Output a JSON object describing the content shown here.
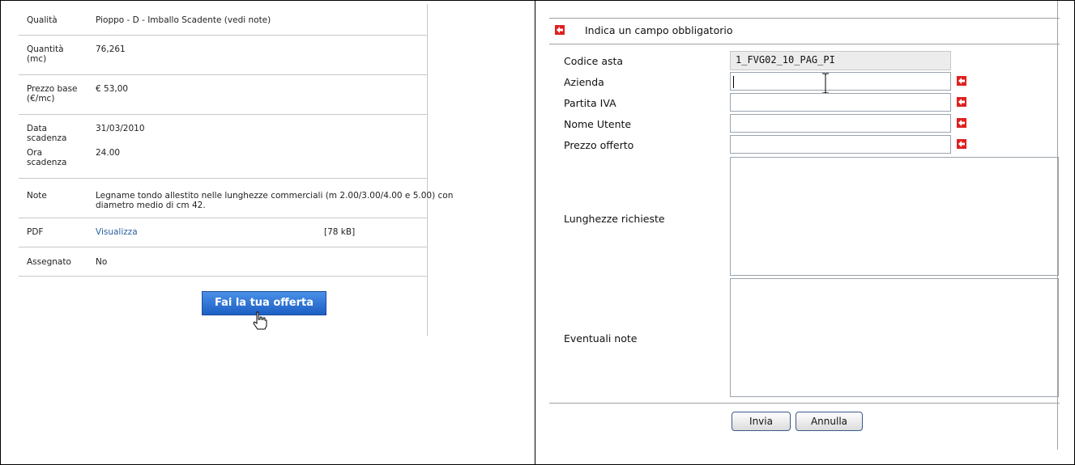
{
  "left": {
    "rows": [
      {
        "label": "Qualità",
        "value": "Pioppo - D - Imballo Scadente (vedi note)"
      },
      {
        "label": "Quantità\n(mc)",
        "value": "76,261"
      },
      {
        "label": "Prezzo base\n(€/mc)",
        "value": "€ 53,00"
      },
      {
        "label": "Data\nscadenza",
        "value": "31/03/2010"
      },
      {
        "label": "Ora\nscadenza",
        "value": "24.00"
      },
      {
        "label": "Note",
        "value": "Legname tondo allestito nelle lunghezze commerciali (m 2.00/3.00/4.00 e 5.00) con\ndiametro medio di cm 42."
      },
      {
        "label": "PDF",
        "value": "Visualizza",
        "size": "[78 kB]"
      },
      {
        "label": "Assegnato",
        "value": "No"
      }
    ],
    "offer_button": "Fai la tua offerta"
  },
  "right": {
    "legend": "Indica un campo obbligatorio",
    "fields": {
      "codice_asta": {
        "label": "Codice asta",
        "value": "1_FVG02_10_PAG_PI"
      },
      "azienda": {
        "label": "Azienda",
        "value": ""
      },
      "partita_iva": {
        "label": "Partita IVA",
        "value": ""
      },
      "nome_utente": {
        "label": "Nome Utente",
        "value": ""
      },
      "prezzo_offerto": {
        "label": "Prezzo offerto",
        "value": ""
      },
      "lunghezze": {
        "label": "Lunghezze richieste",
        "value": ""
      },
      "note": {
        "label": "Eventuali note",
        "value": ""
      }
    },
    "buttons": {
      "submit": "Invia",
      "cancel": "Annulla"
    }
  },
  "colors": {
    "required_icon": "#e02020",
    "offer_button": "#1c5fc4",
    "link": "#2a5f9e"
  }
}
